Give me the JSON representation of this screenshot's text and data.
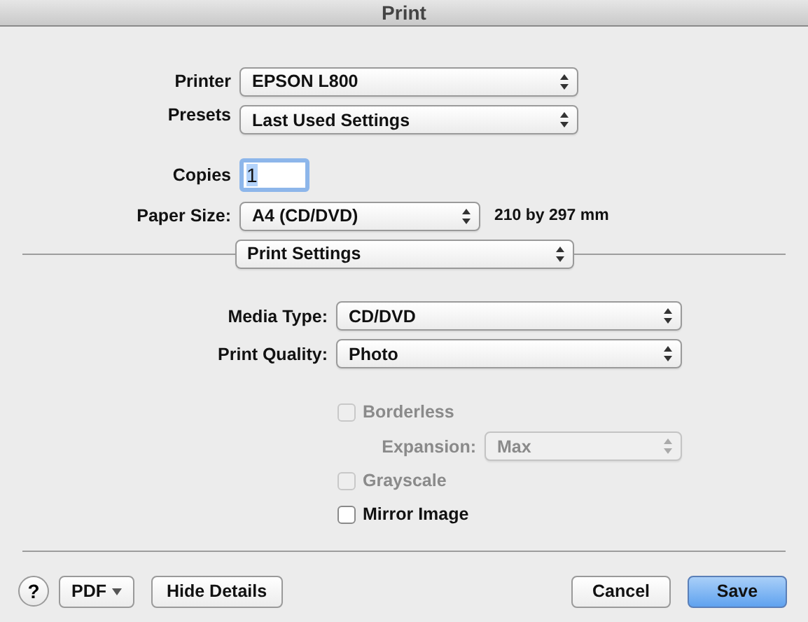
{
  "window": {
    "title": "Print"
  },
  "top_fields": [
    {
      "kind": "popup",
      "label": "Printer",
      "value": "EPSON L800"
    },
    {
      "kind": "popup",
      "label": "Presets",
      "value": "Last Used Settings"
    },
    {
      "kind": "text",
      "label": "Copies",
      "value": "1",
      "text_selected": true
    },
    {
      "kind": "popup",
      "label": "Paper Size:",
      "value": "A4 (CD/DVD)",
      "note": "210 by 297 mm"
    }
  ],
  "section_popup": {
    "value": "Print Settings"
  },
  "settings": [
    {
      "label": "Media Type:",
      "value": "CD/DVD"
    },
    {
      "label": "Print Quality:",
      "value": "Photo"
    }
  ],
  "options": [
    {
      "kind": "checkbox",
      "label": "Borderless",
      "checked": false,
      "disabled": true
    },
    {
      "kind": "popup",
      "label": "Expansion:",
      "value": "Max",
      "disabled": true
    },
    {
      "kind": "checkbox",
      "label": "Grayscale",
      "checked": false,
      "disabled": true
    },
    {
      "kind": "checkbox",
      "label": "Mirror Image",
      "checked": false,
      "disabled": false
    }
  ],
  "footer": {
    "help": "?",
    "pdf": "PDF",
    "hide_details": "Hide Details",
    "cancel": "Cancel",
    "save": "Save"
  }
}
